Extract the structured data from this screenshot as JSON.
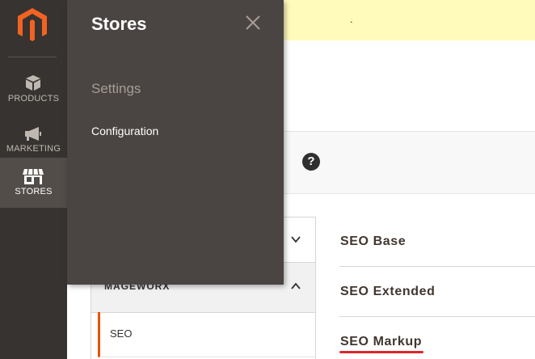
{
  "nav": {
    "items": [
      {
        "label": "PRODUCTS",
        "icon": "cube-icon"
      },
      {
        "label": "MARKETING",
        "icon": "megaphone-icon"
      },
      {
        "label": "STORES",
        "icon": "storefront-icon",
        "active": true
      }
    ]
  },
  "notice": {
    "text": "."
  },
  "config": {
    "group_title": "MAGEWORX",
    "active_item": "SEO",
    "sections": [
      "SEO Base",
      "SEO Extended",
      "SEO Markup"
    ]
  },
  "flyout": {
    "title": "Stores",
    "section_title": "Settings",
    "links": [
      "Configuration"
    ]
  },
  "colors": {
    "nav_bg": "#373330",
    "flyout_bg": "#4a4542",
    "accent": "#eb5202",
    "notice_bg": "#fffbbb",
    "highlight": "#e0262d"
  }
}
